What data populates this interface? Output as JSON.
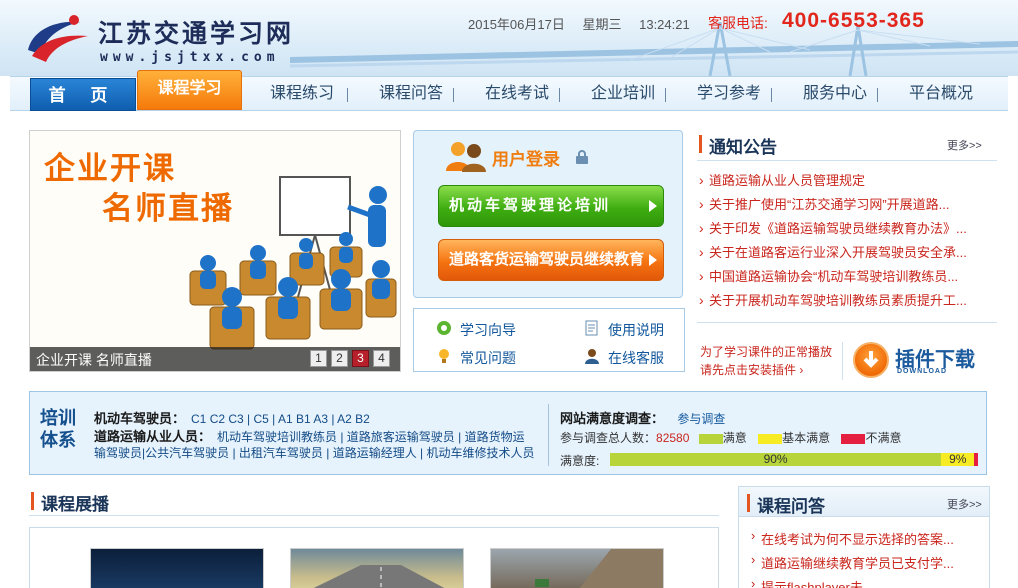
{
  "header": {
    "site_title": "江苏交通学习网",
    "site_url": "www.jsjtxx.com",
    "date": "2015年06月17日",
    "weekday": "星期三",
    "time": "13:24:21",
    "phone_label": "客服电话:",
    "phone": "400-6553-365"
  },
  "nav": {
    "items": [
      {
        "label": "首 页"
      },
      {
        "label": "课程学习"
      },
      {
        "label": "课程练习"
      },
      {
        "label": "课程问答"
      },
      {
        "label": "在线考试"
      },
      {
        "label": "企业培训"
      },
      {
        "label": "学习参考"
      },
      {
        "label": "服务中心"
      },
      {
        "label": "平台概况"
      }
    ]
  },
  "banner": {
    "headline1": "企业开课",
    "headline2": "名师直播",
    "caption": "企业开课 名师直播",
    "pages": [
      "1",
      "2",
      "3",
      "4"
    ],
    "current_page": "3"
  },
  "login": {
    "title": "用户登录",
    "btn_vehicle": "机动车驾驶理论培训",
    "btn_road": "道路客货运输驾驶员继续教育"
  },
  "quick_links": {
    "guide": "学习向导",
    "manual": "使用说明",
    "faq": "常见问题",
    "support": "在线客服"
  },
  "notice": {
    "title": "通知公告",
    "more": "更多>>",
    "items": [
      "道路运输从业人员管理规定",
      "关于推广使用“江苏交通学习网”开展道路...",
      "关于印发《道路运输驾驶员继续教育办法》...",
      "关于在道路客运行业深入开展驾驶员安全承...",
      "中国道路运输协会“机动车驾驶培训教练员...",
      "关于开展机动车驾驶培训教练员素质提升工..."
    ]
  },
  "plugin": {
    "hint_line1": "为了学习课件的正常播放",
    "hint_line2": "请先点击安装插件 ›",
    "label": "插件下载",
    "sub": "DOWNLOAD"
  },
  "training": {
    "label": "培训体系",
    "vehicle_title": "机动车驾驶员：",
    "vehicle_list": "C1 C2 C3 | C5 | A1 B1 A3 | A2 B2",
    "road_title": "道路运输从业人员：",
    "road_line1": "机动车驾驶培训教练员 | 道路旅客运输驾驶员 | 道路货物运",
    "road_line2": "输驾驶员|公共汽车驾驶员 | 出租汽车驾驶员 | 道路运输经理人 | 机动车维修技术人员"
  },
  "survey": {
    "title": "网站满意度调查：",
    "join": "参与调查",
    "total_label": "参与调查总人数：",
    "total": "82580",
    "legend_satisfied": "满意",
    "legend_basic": "基本满意",
    "legend_unsatisfied": "不满意",
    "rate_label": "满意度:",
    "satisfied_pct": 90,
    "basic_pct": 9,
    "satisfied_text": "90%",
    "basic_text": "9%",
    "colors": {
      "satisfied": "#b7d53a",
      "basic": "#f7ec24",
      "unsatisfied": "#e51f3f"
    }
  },
  "showcase": {
    "title": "课程展播"
  },
  "qa": {
    "title": "课程问答",
    "more": "更多>>",
    "items": [
      "在线考试为何不显示选择的答案...",
      "道路运输继续教育学员已支付学...",
      "提示flashplayer未"
    ]
  }
}
